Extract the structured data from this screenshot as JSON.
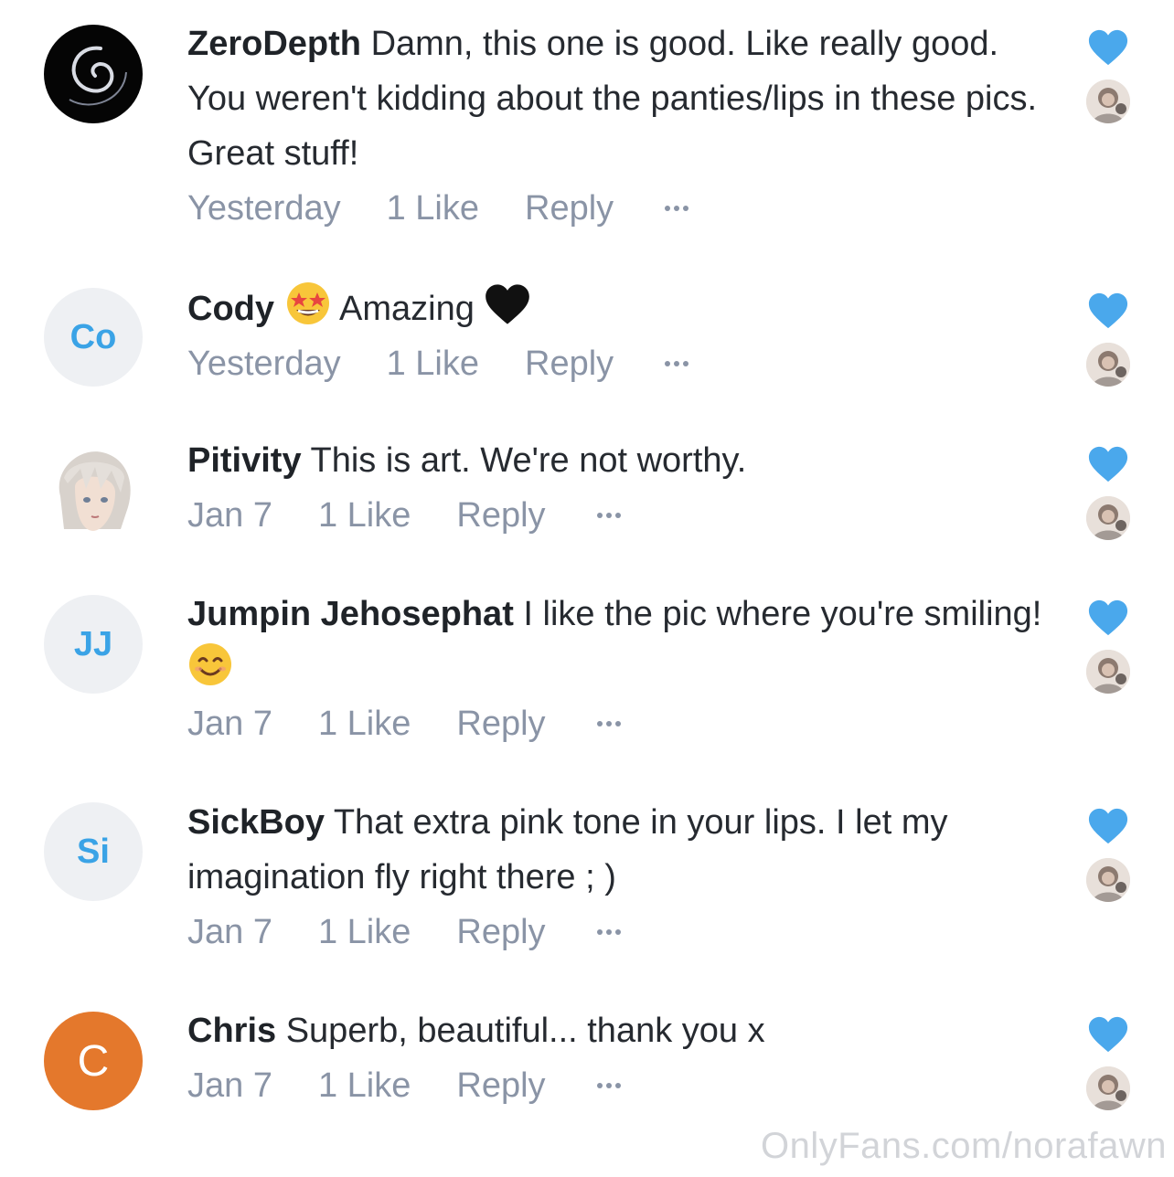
{
  "comments": [
    {
      "author": "ZeroDepth",
      "text": "Damn, this one is good. Like really good. You weren't kidding about the panties/lips in these pics. Great stuff!",
      "date": "Yesterday",
      "likes": "1 Like",
      "reply": "Reply",
      "avatar": "swirl-avatar"
    },
    {
      "author": "Cody",
      "emoji_after_author": "star-struck-emoji",
      "text": "Amazing",
      "emoji_after_text": "black-heart-emoji",
      "date": "Yesterday",
      "likes": "1 Like",
      "reply": "Reply",
      "initials": "Co"
    },
    {
      "author": "Pitivity",
      "text": "This is art. We're not worthy.",
      "date": "Jan 7",
      "likes": "1 Like",
      "reply": "Reply",
      "avatar": "anime-character-avatar"
    },
    {
      "author": "Jumpin Jehosephat",
      "text": "I like the pic where you're smiling!",
      "emoji_after_text": "smiling-face-emoji",
      "date": "Jan 7",
      "likes": "1 Like",
      "reply": "Reply",
      "initials": "JJ"
    },
    {
      "author": "SickBoy",
      "text": "That extra pink tone in your lips. I let my imagination fly right there ; )",
      "date": "Jan 7",
      "likes": "1 Like",
      "reply": "Reply",
      "initials": "Si"
    },
    {
      "author": "Chris",
      "text": "Superb, beautiful... thank you x",
      "date": "Jan 7",
      "likes": "1 Like",
      "reply": "Reply",
      "initials": "C"
    }
  ],
  "watermark": "OnlyFans.com/norafawn",
  "colors": {
    "accent": "#3aa3e6",
    "heart": "#4aa8ec",
    "meta_text": "#8a94a6",
    "body_text": "#262a30",
    "orange_avatar": "#e4782c"
  }
}
